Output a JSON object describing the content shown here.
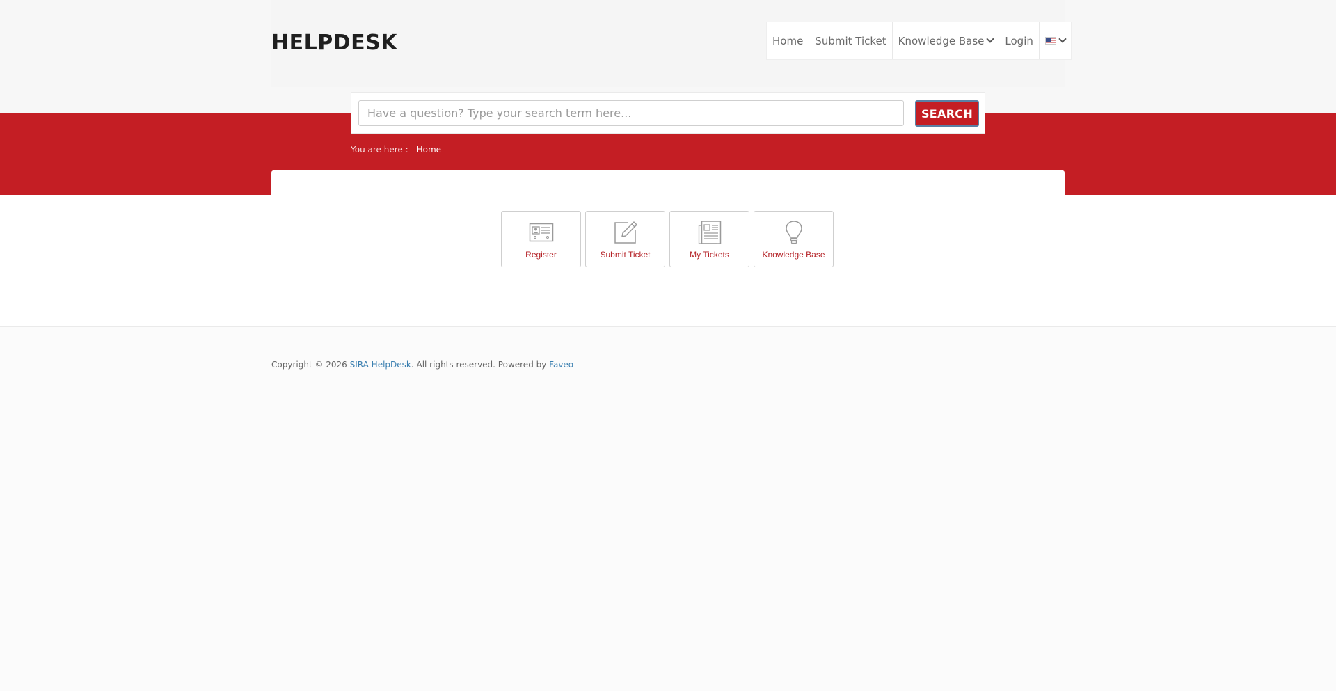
{
  "header": {
    "logo": "HELPDESK",
    "nav": [
      {
        "label": "Home"
      },
      {
        "label": "Submit Ticket"
      },
      {
        "label": "Knowledge Base"
      },
      {
        "label": "Login"
      }
    ],
    "language_icon": "us-flag-icon"
  },
  "search": {
    "placeholder": "Have a question? Type your search term here...",
    "button_label": "SEARCH"
  },
  "breadcrumb": {
    "label": "You are here :",
    "current": "Home"
  },
  "tiles": [
    {
      "label": "Register",
      "icon": "id-card-icon"
    },
    {
      "label": "Submit Ticket",
      "icon": "edit-icon"
    },
    {
      "label": "My Tickets",
      "icon": "document-list-icon"
    },
    {
      "label": "Knowledge Base",
      "icon": "lightbulb-icon"
    }
  ],
  "footer": {
    "copyright_prefix": "Copyright © 2026",
    "company": "SIRA HelpDesk",
    "rights": ". All rights reserved. Powered by",
    "powered_by": "Faveo"
  },
  "colors": {
    "brand_red": "#c41e24",
    "link_blue": "#3a7fb0"
  }
}
